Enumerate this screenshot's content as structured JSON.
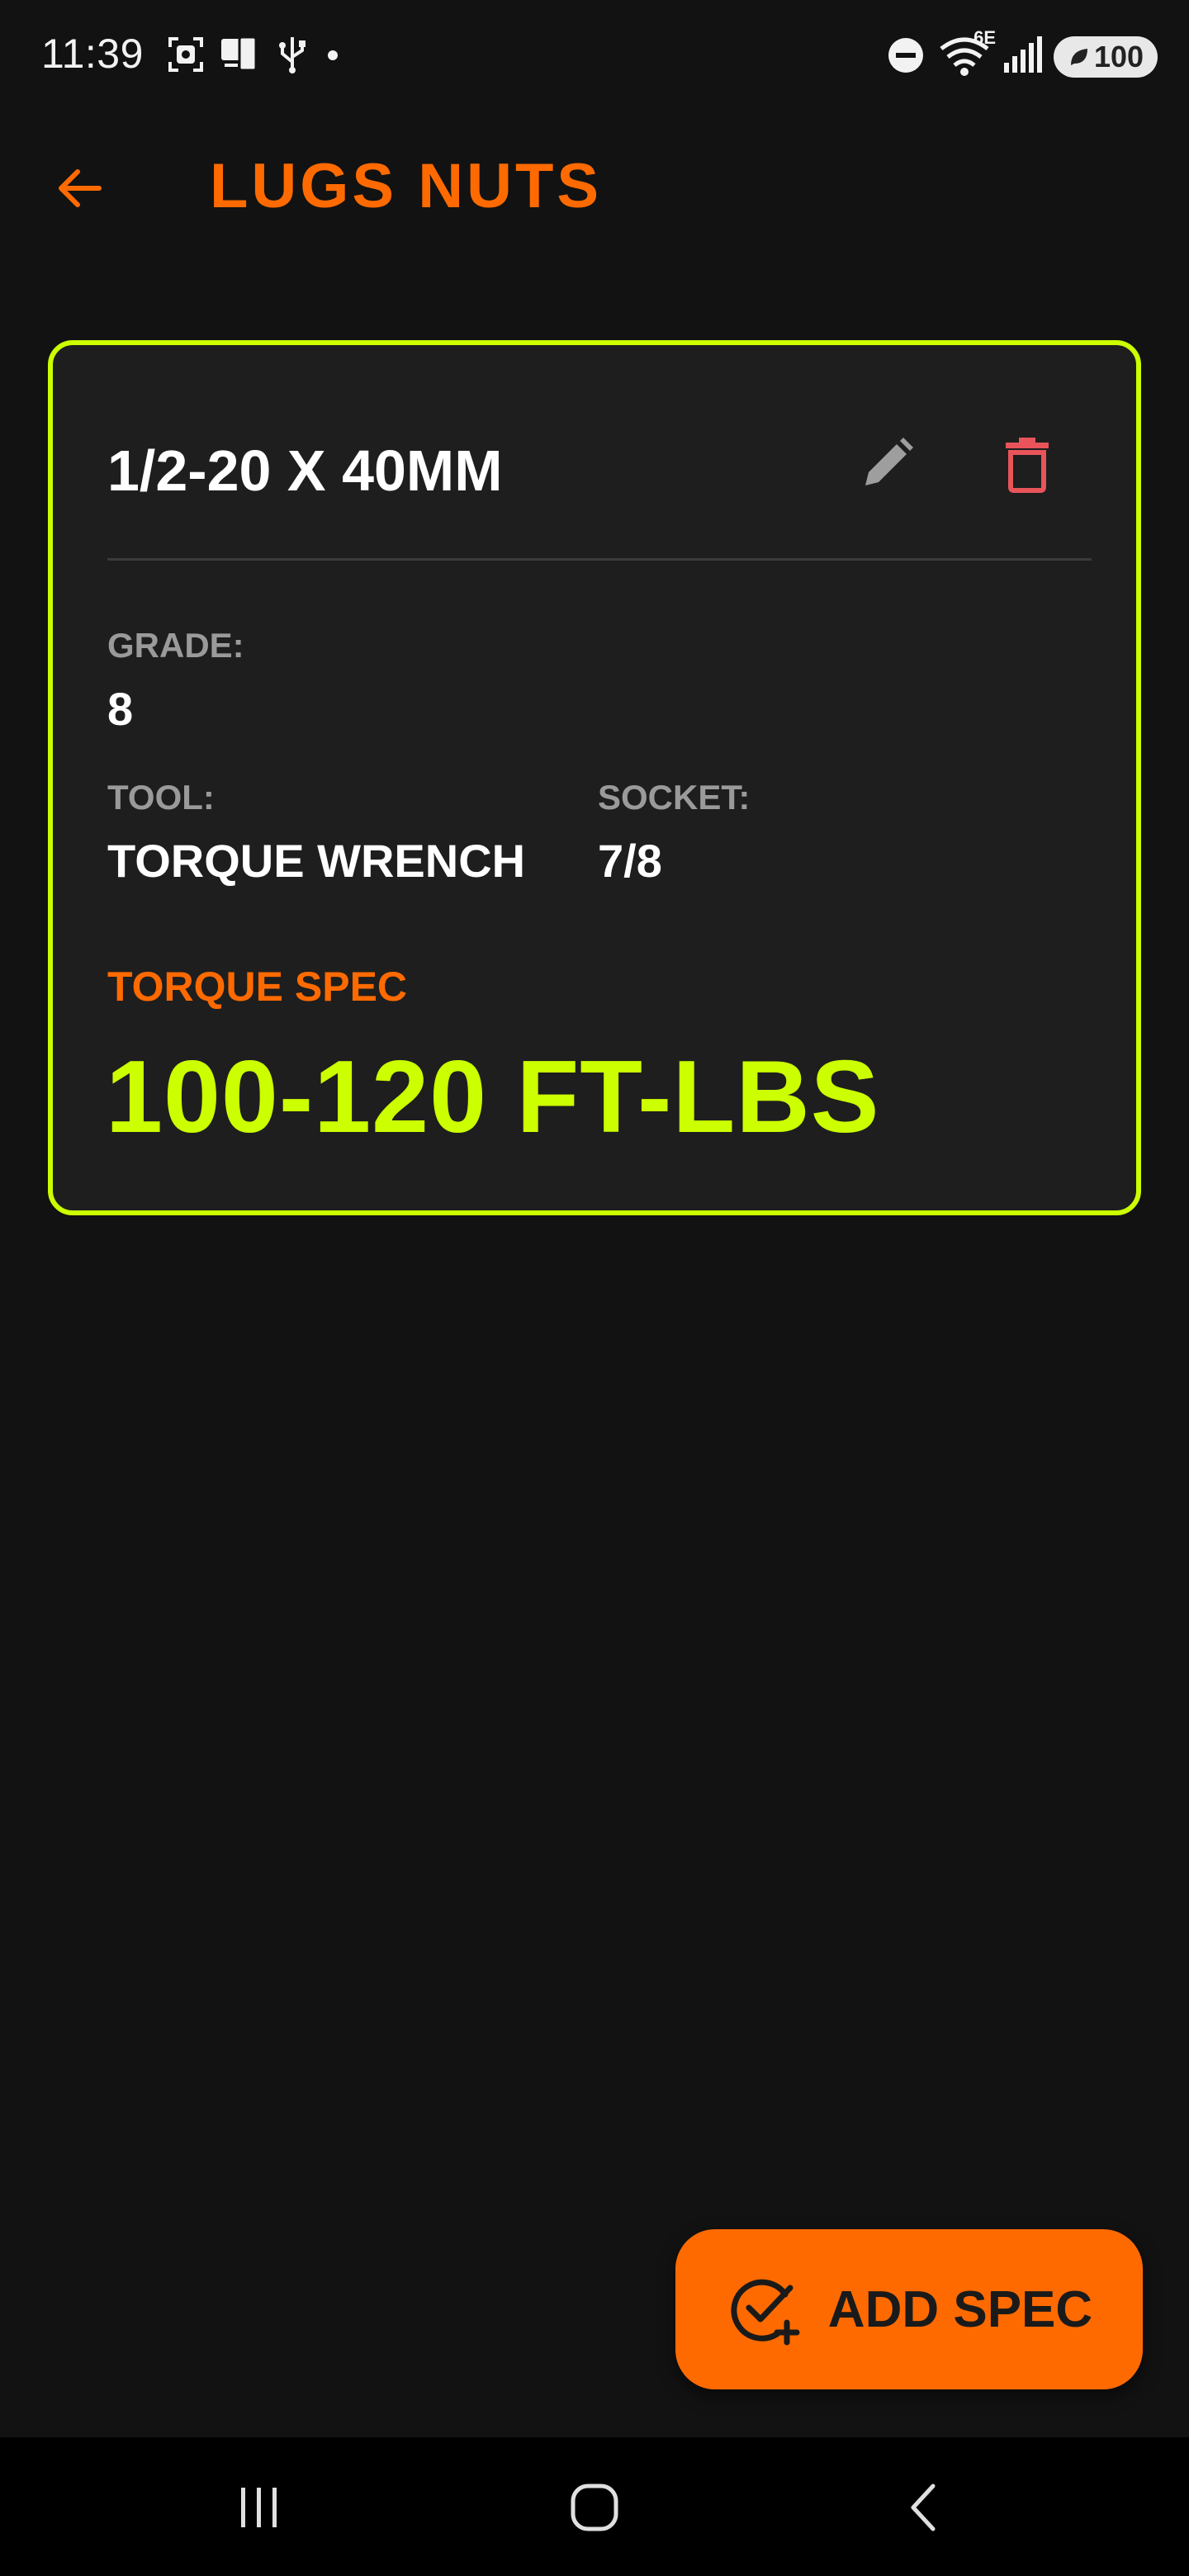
{
  "status_bar": {
    "time": "11:39",
    "network": "6E",
    "battery": "100",
    "icons_left": [
      "screenshot-icon",
      "device-icon",
      "usb-icon",
      "dot-icon"
    ],
    "icons_right": [
      "dnd-icon",
      "wifi-icon",
      "signal-icon",
      "battery-icon"
    ]
  },
  "app_bar": {
    "title": "LUGS NUTS",
    "back_icon": "arrow-left-icon"
  },
  "spec_card": {
    "title": "1/2-20 X 40MM",
    "grade_label": "GRADE:",
    "grade_value": "8",
    "tool_label": "TOOL:",
    "tool_value": "TORQUE WRENCH",
    "socket_label": "SOCKET:",
    "socket_value": "7/8",
    "torque_label": "TORQUE SPEC",
    "torque_value": "100-120 FT-LBS",
    "edit_icon": "pencil-icon",
    "delete_icon": "trash-icon"
  },
  "fab": {
    "label": "ADD SPEC",
    "icon": "check-circle-plus-icon"
  },
  "nav_bar": {
    "items": [
      "recents-icon",
      "home-icon",
      "back-icon"
    ]
  },
  "colors": {
    "accent_orange": "#ff6a00",
    "accent_lime": "#ccff00",
    "background": "#121212",
    "card": "#1e1e1e",
    "delete_red": "#e8545a",
    "edit_gray": "#9e9e9e"
  }
}
